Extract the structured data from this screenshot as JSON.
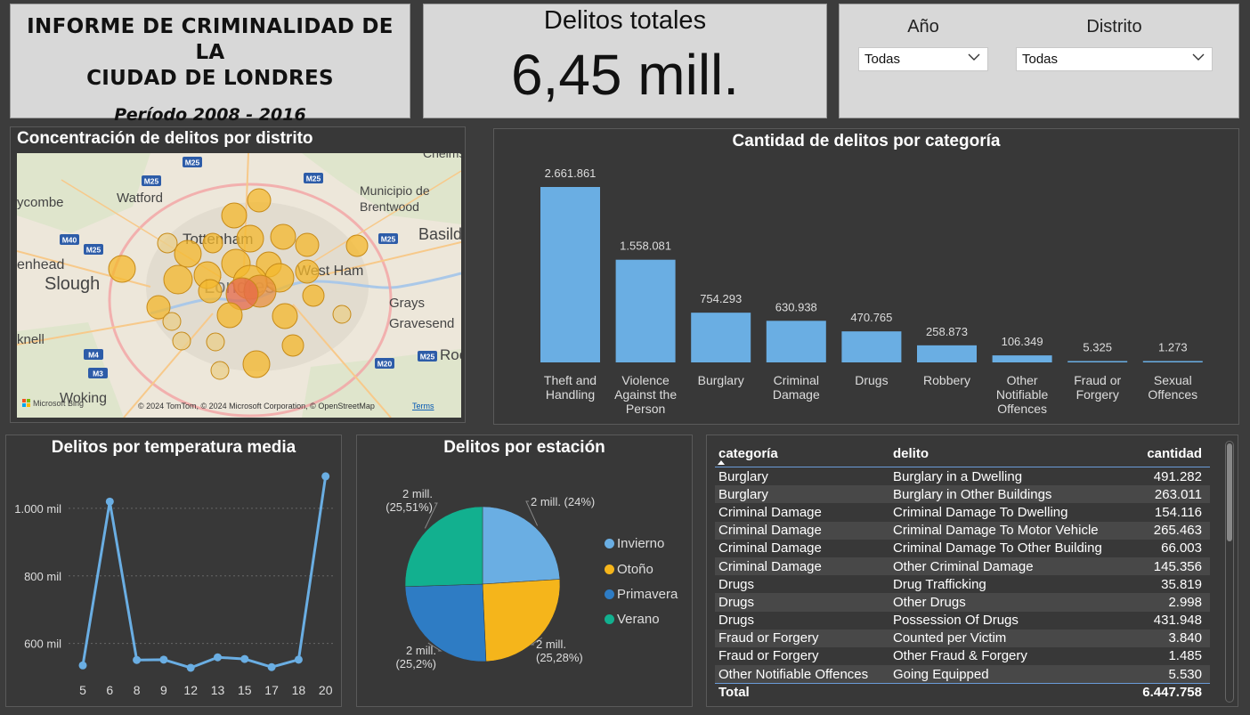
{
  "header": {
    "title_line1": "INFORME DE CRIMINALIDAD DE LA",
    "title_line2": "CIUDAD DE LONDRES",
    "period": "Período 2008 - 2016"
  },
  "kpi": {
    "label": "Delitos totales",
    "value": "6,45 mill."
  },
  "filters": {
    "year": {
      "label": "Año",
      "value": "Todas"
    },
    "district": {
      "label": "Distrito",
      "value": "Todas"
    }
  },
  "map": {
    "title": "Concentración de delitos por distrito",
    "labels": [
      "Watford",
      "Tottenham",
      "Municipio de",
      "Brentwood",
      "Basildon",
      "West Ham",
      "Slough",
      "Londres",
      "Grays",
      "Gravesend",
      "Woking",
      "ycombe",
      "enhead",
      "knell",
      "Roc",
      "Chelms"
    ],
    "road_labels": [
      "M25",
      "M25",
      "M40",
      "M25",
      "M25",
      "M4",
      "M3",
      "M20",
      "M25",
      "M25"
    ],
    "attribution": "© 2024 TomTom, © 2024 Microsoft Corporation, © OpenStreetMap",
    "terms": "Terms",
    "bing": "Microsoft Bing"
  },
  "bar_chart": {
    "title": "Cantidad de delitos por categoría",
    "color": "#6aaee3"
  },
  "chart_data": [
    {
      "type": "bar",
      "title": "Cantidad de delitos por categoría",
      "categories": [
        "Theft and Handling",
        "Violence Against the Person",
        "Burglary",
        "Criminal Damage",
        "Drugs",
        "Robbery",
        "Other Notifiable Offences",
        "Fraud or Forgery",
        "Sexual Offences"
      ],
      "category_lines": [
        [
          "Theft and",
          "Handling"
        ],
        [
          "Violence",
          "Against the",
          "Person"
        ],
        [
          "Burglary"
        ],
        [
          "Criminal",
          "Damage"
        ],
        [
          "Drugs"
        ],
        [
          "Robbery"
        ],
        [
          "Other",
          "Notifiable",
          "Offences"
        ],
        [
          "Fraud or",
          "Forgery"
        ],
        [
          "Sexual",
          "Offences"
        ]
      ],
      "values": [
        2661861,
        1558081,
        754293,
        630938,
        470765,
        258873,
        106349,
        5325,
        1273
      ],
      "data_labels": [
        "2.661.861",
        "1.558.081",
        "754.293",
        "630.938",
        "470.765",
        "258.873",
        "106.349",
        "5.325",
        "1.273"
      ],
      "ylim": [
        0,
        2661861
      ]
    },
    {
      "type": "line",
      "title": "Delitos por temperatura media",
      "x": [
        5,
        6,
        8,
        9,
        12,
        13,
        15,
        17,
        18,
        20
      ],
      "values": [
        535000,
        1020000,
        551000,
        552000,
        528000,
        559000,
        554000,
        530000,
        552000,
        1095000
      ],
      "yticks": [
        600000,
        800000,
        1000000
      ],
      "ytick_labels": [
        "600 mil",
        "800 mil",
        "1.000 mil"
      ],
      "ylim": [
        520000,
        1100000
      ],
      "grid": true,
      "color": "#6aaee3"
    },
    {
      "type": "pie",
      "title": "Delitos por estación",
      "series": [
        {
          "name": "Invierno",
          "value": 24.0,
          "label_line1": "2 mill. (24%)",
          "label_line2": "",
          "color": "#6aaee3"
        },
        {
          "name": "Otoño",
          "value": 25.28,
          "label_line1": "2 mill.",
          "label_line2": "(25,28%)",
          "color": "#f5b51b"
        },
        {
          "name": "Primavera",
          "value": 25.2,
          "label_line1": "2 mill.",
          "label_line2": "(25,2%)",
          "color": "#2e7cc4"
        },
        {
          "name": "Verano",
          "value": 25.51,
          "label_line1": "2 mill.",
          "label_line2": "(25,51%)",
          "color": "#12b08f"
        }
      ]
    }
  ],
  "line_chart": {
    "title": "Delitos por temperatura media"
  },
  "pie_chart": {
    "title": "Delitos por estación"
  },
  "table": {
    "headers": [
      "categoría",
      "delito",
      "cantidad"
    ],
    "rows": [
      [
        "Burglary",
        "Burglary in a Dwelling",
        "491.282"
      ],
      [
        "Burglary",
        "Burglary in Other Buildings",
        "263.011"
      ],
      [
        "Criminal Damage",
        "Criminal Damage To Dwelling",
        "154.116"
      ],
      [
        "Criminal Damage",
        "Criminal Damage To Motor Vehicle",
        "265.463"
      ],
      [
        "Criminal Damage",
        "Criminal Damage To Other Building",
        "66.003"
      ],
      [
        "Criminal Damage",
        "Other Criminal Damage",
        "145.356"
      ],
      [
        "Drugs",
        "Drug Trafficking",
        "35.819"
      ],
      [
        "Drugs",
        "Other Drugs",
        "2.998"
      ],
      [
        "Drugs",
        "Possession Of Drugs",
        "431.948"
      ],
      [
        "Fraud or Forgery",
        "Counted per Victim",
        "3.840"
      ],
      [
        "Fraud or Forgery",
        "Other Fraud & Forgery",
        "1.485"
      ],
      [
        "Other Notifiable Offences",
        "Going Equipped",
        "5.530"
      ]
    ],
    "total_label": "Total",
    "total_value": "6.447.758"
  }
}
